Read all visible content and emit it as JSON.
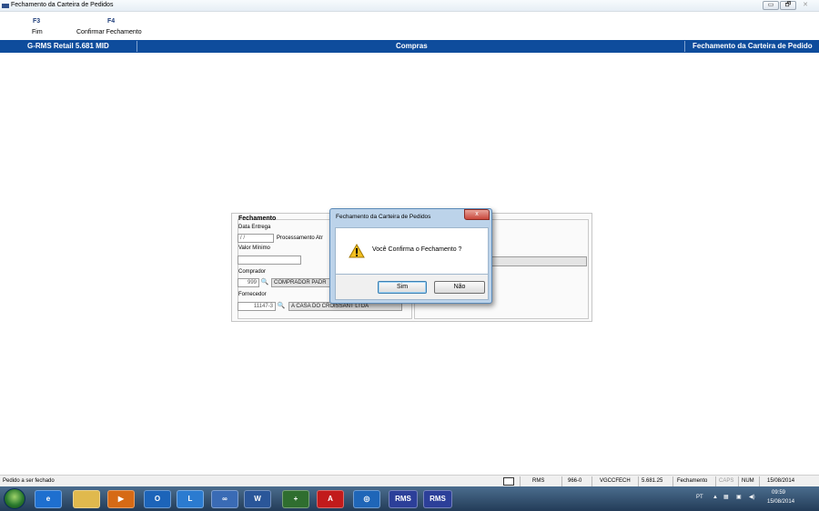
{
  "window": {
    "title": "Fechamento da Carteira de Pedidos",
    "minimize": "▭",
    "restore": "🗗",
    "close": "✕"
  },
  "fkeys": [
    {
      "key": "F3",
      "label": "Fim"
    },
    {
      "key": "F4",
      "label": "Confirmar Fechamento"
    }
  ],
  "header": {
    "app": "G-RMS Retail 5.681 MID",
    "module": "Compras",
    "screen": "Fechamento da Carteira de Pedido"
  },
  "form": {
    "group_title": "Fechamento",
    "data_entrega_label": "Data Entrega",
    "data_entrega_value": "/ /",
    "processamento_label": "Processamento Atr",
    "valor_minimo_label": "Valor Mínimo",
    "valor_minimo_value": "",
    "comprador_label": "Comprador",
    "comprador_code": "999",
    "comprador_name": "COMPRADOR PADR",
    "fornecedor_label": "Fornecedor",
    "fornecedor_code": "11147-3",
    "fornecedor_name": "A CASA DO CROISSANT LTDA"
  },
  "dialog": {
    "title": "Fechamento da Carteira de Pedidos",
    "close": "x",
    "message": "Você Confirma o Fechamento ?",
    "yes": "Sim",
    "no": "Não"
  },
  "status": {
    "message": "Pedido a ser fechado",
    "system": "RMS",
    "code": "966-0",
    "program": "VGCCFECH",
    "version": "5.681.25",
    "screen": "Fechamento",
    "caps": "CAPS",
    "num": "NUM",
    "date": "15/08/2014"
  },
  "taskbar": {
    "apps": [
      "ie-icon",
      "explorer-icon",
      "media-player-icon",
      "outlook-icon",
      "lync-icon",
      "app-icon",
      "word-icon",
      "lotto-icon",
      "acrobat-icon",
      "globe-icon",
      "rms-icon",
      "rms-icon"
    ],
    "rms1": "RMS",
    "rms2": "RMS",
    "lang": "PT",
    "time": "09:59",
    "date": "15/08/2014"
  }
}
